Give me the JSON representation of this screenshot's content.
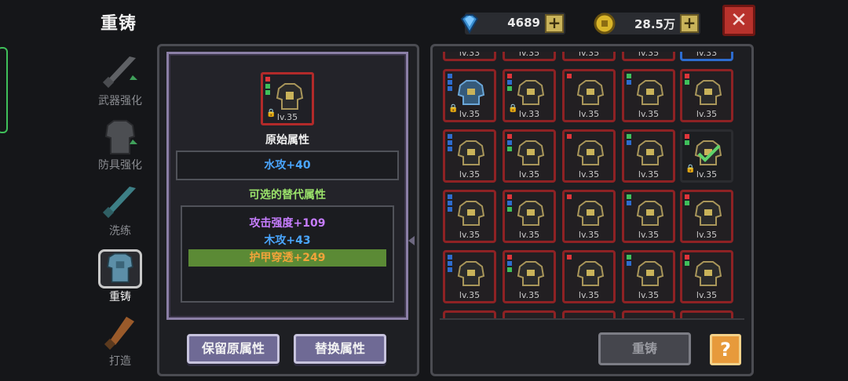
{
  "header": {
    "title": "重铸"
  },
  "currency": {
    "gems": "4689",
    "gold": "28.5万"
  },
  "sidebar": {
    "items": [
      {
        "label": "武器强化",
        "icon": "sword-icon",
        "active": false
      },
      {
        "label": "防具强化",
        "icon": "armor-icon",
        "active": false
      },
      {
        "label": "洗练",
        "icon": "sword-icon",
        "active": false
      },
      {
        "label": "重铸",
        "icon": "armor-icon",
        "active": true
      },
      {
        "label": "打造",
        "icon": "hammer-icon",
        "active": false
      }
    ]
  },
  "reforge": {
    "item_level": "lv.35",
    "original_title": "原始属性",
    "original_attr": "水攻+40",
    "alt_title": "可选的替代属性",
    "alt_attrs": [
      "攻击强度+109",
      "木攻+43",
      "护甲穿透+249"
    ],
    "alt_selected": 2,
    "keep_label": "保留原属性",
    "replace_label": "替换属性"
  },
  "colors": {
    "original_attr": "#4aa6ff",
    "alt_title": "#9be36b",
    "alt_0": "#c77dff",
    "alt_1": "#4aa6ff",
    "alt_2": "#f2a33a",
    "alt_selected_bg": "#5b8a35",
    "rarity_red": "#8e2224",
    "rarity_blue": "#2d6ccf"
  },
  "inventory": {
    "top_row_levels": [
      "lv.33",
      "lv.35",
      "lv.35",
      "lv.35",
      "lv.33"
    ],
    "rows": [
      [
        "lv.35",
        "lv.33",
        "lv.35",
        "lv.35",
        "lv.35"
      ],
      [
        "lv.35",
        "lv.35",
        "lv.35",
        "lv.35",
        "lv.35"
      ],
      [
        "lv.35",
        "lv.35",
        "lv.35",
        "lv.35",
        "lv.35"
      ],
      [
        "lv.35",
        "lv.35",
        "lv.35",
        "lv.35",
        "lv.35"
      ]
    ],
    "reforge_button": "重铸",
    "help_button": "?"
  }
}
